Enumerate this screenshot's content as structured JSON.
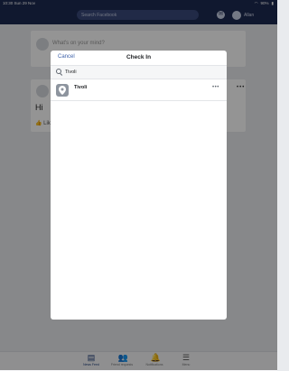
{
  "status": {
    "time": "10:30",
    "date": "Sun 29 Nov",
    "battery": "90%"
  },
  "topnav": {
    "search_placeholder": "Search Facebook",
    "user_name": "Allan"
  },
  "feed": {
    "composer_placeholder": "What's on your mind?",
    "post_text": "Hi",
    "like_label": "Like"
  },
  "modal": {
    "cancel_label": "Cancel",
    "title": "Check In",
    "search_value": "Tivoli",
    "results": [
      {
        "name": "Tivoli"
      }
    ]
  },
  "tabbar": {
    "tabs": [
      {
        "label": "News Feed",
        "icon": "news-feed-icon"
      },
      {
        "label": "Friend requests",
        "icon": "friends-icon"
      },
      {
        "label": "Notifications",
        "icon": "bell-icon"
      },
      {
        "label": "Menu",
        "icon": "menu-icon"
      }
    ]
  },
  "colors": {
    "nav": "#1d2a52",
    "accent": "#3b5fa8"
  }
}
